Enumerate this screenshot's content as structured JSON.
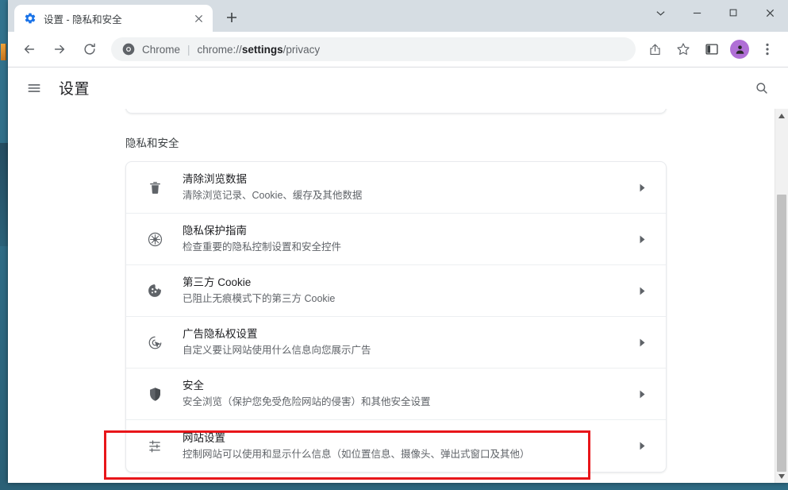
{
  "window": {
    "controls": [
      {
        "name": "tab-search",
        "glyph": "⌄"
      },
      {
        "name": "minimize",
        "glyph": "—"
      },
      {
        "name": "maximize",
        "glyph": "□"
      },
      {
        "name": "close",
        "glyph": "✕"
      }
    ]
  },
  "tab": {
    "title": "设置 - 隐私和安全",
    "favicon": "settings-gear-icon",
    "close_label": "✕",
    "newtab_label": "+"
  },
  "toolbar": {
    "back": "←",
    "forward": "→",
    "reload": "↻",
    "omnibox": {
      "site_label": "Chrome",
      "separator": "|",
      "url_prefix": "chrome://",
      "url_bold": "settings",
      "url_suffix": "/privacy",
      "full_url": "chrome://settings/privacy"
    },
    "share_icon": "share-icon",
    "bookmark_icon": "star-icon",
    "sidepanel_icon": "side-panel-icon",
    "avatar_icon": "profile-avatar",
    "menu_icon": "three-dot-menu-icon"
  },
  "settings": {
    "menu_label": "≡",
    "title": "设置",
    "search_label": "search-icon",
    "section_title": "隐私和安全",
    "rows": [
      {
        "icon": "trash-icon",
        "title": "清除浏览数据",
        "sub": "清除浏览记录、Cookie、缓存及其他数据",
        "arrow": "▶",
        "highlighted": false
      },
      {
        "icon": "privacy-guide-icon",
        "title": "隐私保护指南",
        "sub": "检查重要的隐私控制设置和安全控件",
        "arrow": "▶",
        "highlighted": false
      },
      {
        "icon": "cookie-icon",
        "title": "第三方 Cookie",
        "sub": "已阻止无痕模式下的第三方 Cookie",
        "arrow": "▶",
        "highlighted": false
      },
      {
        "icon": "ad-privacy-icon",
        "title": "广告隐私权设置",
        "sub": "自定义要让网站使用什么信息向您展示广告",
        "arrow": "▶",
        "highlighted": false
      },
      {
        "icon": "shield-icon",
        "title": "安全",
        "sub": "安全浏览（保护您免受危险网站的侵害）和其他安全设置",
        "arrow": "▶",
        "highlighted": false
      },
      {
        "icon": "sliders-icon",
        "title": "网站设置",
        "sub": "控制网站可以使用和显示什么信息（如位置信息、摄像头、弹出式窗口及其他）",
        "arrow": "▶",
        "highlighted": true
      }
    ]
  },
  "scrollbar": {
    "up_arrow": "▲",
    "down_arrow": "▼"
  },
  "colors": {
    "annotation_red": "#e8161a",
    "avatar_purple": "#b06fd6",
    "accent_blue": "#1a73e8",
    "desktop_teal": "#2d6a84"
  }
}
